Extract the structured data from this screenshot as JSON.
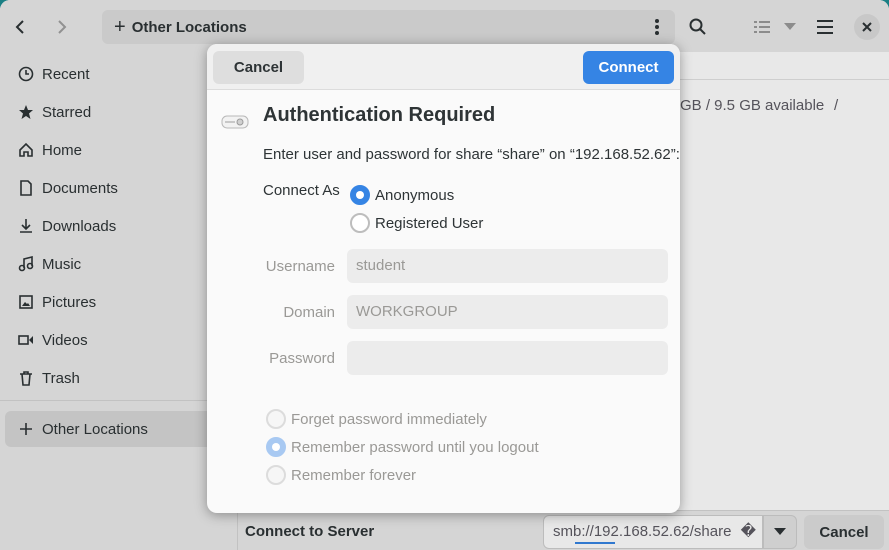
{
  "header": {
    "location": "Other Locations"
  },
  "sidebar": {
    "items": [
      {
        "label": "Recent",
        "icon": "clock-icon"
      },
      {
        "label": "Starred",
        "icon": "star-icon"
      },
      {
        "label": "Home",
        "icon": "home-icon"
      },
      {
        "label": "Documents",
        "icon": "document-icon"
      },
      {
        "label": "Downloads",
        "icon": "download-icon"
      },
      {
        "label": "Music",
        "icon": "music-icon"
      },
      {
        "label": "Pictures",
        "icon": "picture-icon"
      },
      {
        "label": "Videos",
        "icon": "video-icon"
      },
      {
        "label": "Trash",
        "icon": "trash-icon"
      }
    ],
    "other_locations": "Other Locations"
  },
  "main": {
    "available": "GB / 9.5 GB available",
    "slash": "/"
  },
  "bottombar": {
    "label": "Connect to Server",
    "address": "smb://192.168.52.62/share",
    "cancel": "Cancel"
  },
  "dialog": {
    "cancel": "Cancel",
    "connect": "Connect",
    "title": "Authentication Required",
    "message": "Enter user and password for share “share” on “192.168.52.62”:",
    "connect_as_label": "Connect As",
    "connect_as_options": [
      "Anonymous",
      "Registered User"
    ],
    "connect_as_selected": "Anonymous",
    "username_label": "Username",
    "username_value": "student",
    "domain_label": "Domain",
    "domain_value": "WORKGROUP",
    "password_label": "Password",
    "password_value": "",
    "remember_options": [
      "Forget password immediately",
      "Remember password until you logout",
      "Remember forever"
    ],
    "remember_selected": "Remember password until you logout"
  },
  "colors": {
    "accent": "#3584e4",
    "desktop": "#1b7f84"
  }
}
